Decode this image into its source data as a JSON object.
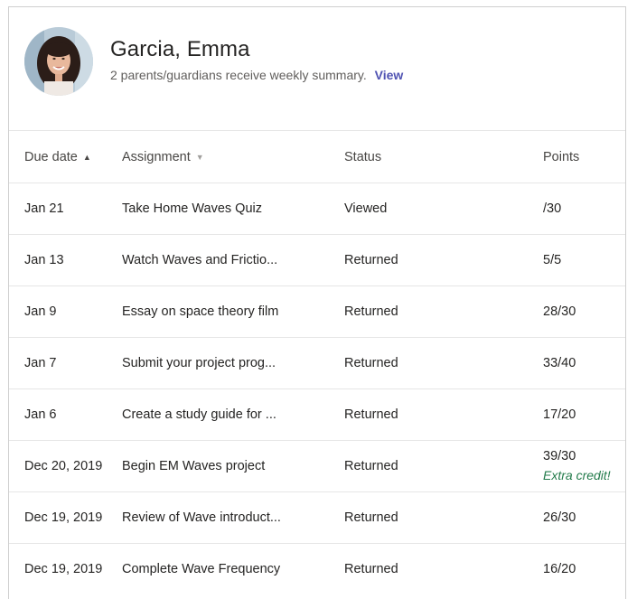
{
  "student": {
    "name": "Garcia, Emma",
    "summary_text": "2 parents/guardians receive weekly summary.",
    "view_link": "View"
  },
  "table": {
    "columns": {
      "due_date": "Due date",
      "assignment": "Assignment",
      "status": "Status",
      "points": "Points"
    },
    "sort_icons": {
      "due_date": "▲",
      "assignment": "▼"
    },
    "rows": [
      {
        "due": "Jan 21",
        "assignment": "Take Home Waves Quiz",
        "status": "Viewed",
        "points": "/30",
        "note": ""
      },
      {
        "due": "Jan 13",
        "assignment": "Watch Waves and Frictio...",
        "status": "Returned",
        "points": "5/5",
        "note": ""
      },
      {
        "due": "Jan 9",
        "assignment": "Essay on space theory film",
        "status": "Returned",
        "points": "28/30",
        "note": ""
      },
      {
        "due": "Jan 7",
        "assignment": "Submit your project prog...",
        "status": "Returned",
        "points": "33/40",
        "note": ""
      },
      {
        "due": "Jan 6",
        "assignment": "Create a study guide for ...",
        "status": "Returned",
        "points": "17/20",
        "note": ""
      },
      {
        "due": "Dec 20, 2019",
        "assignment": "Begin EM Waves project",
        "status": "Returned",
        "points": "39/30",
        "note": "Extra credit!"
      },
      {
        "due": "Dec 19, 2019",
        "assignment": "Review of Wave introduct...",
        "status": "Returned",
        "points": "26/30",
        "note": ""
      },
      {
        "due": "Dec 19, 2019",
        "assignment": "Complete Wave Frequency",
        "status": "Returned",
        "points": "16/20",
        "note": ""
      }
    ]
  },
  "colors": {
    "link": "#4f52b2",
    "extra_credit": "#237b4b",
    "divider": "#e6e6e6"
  }
}
